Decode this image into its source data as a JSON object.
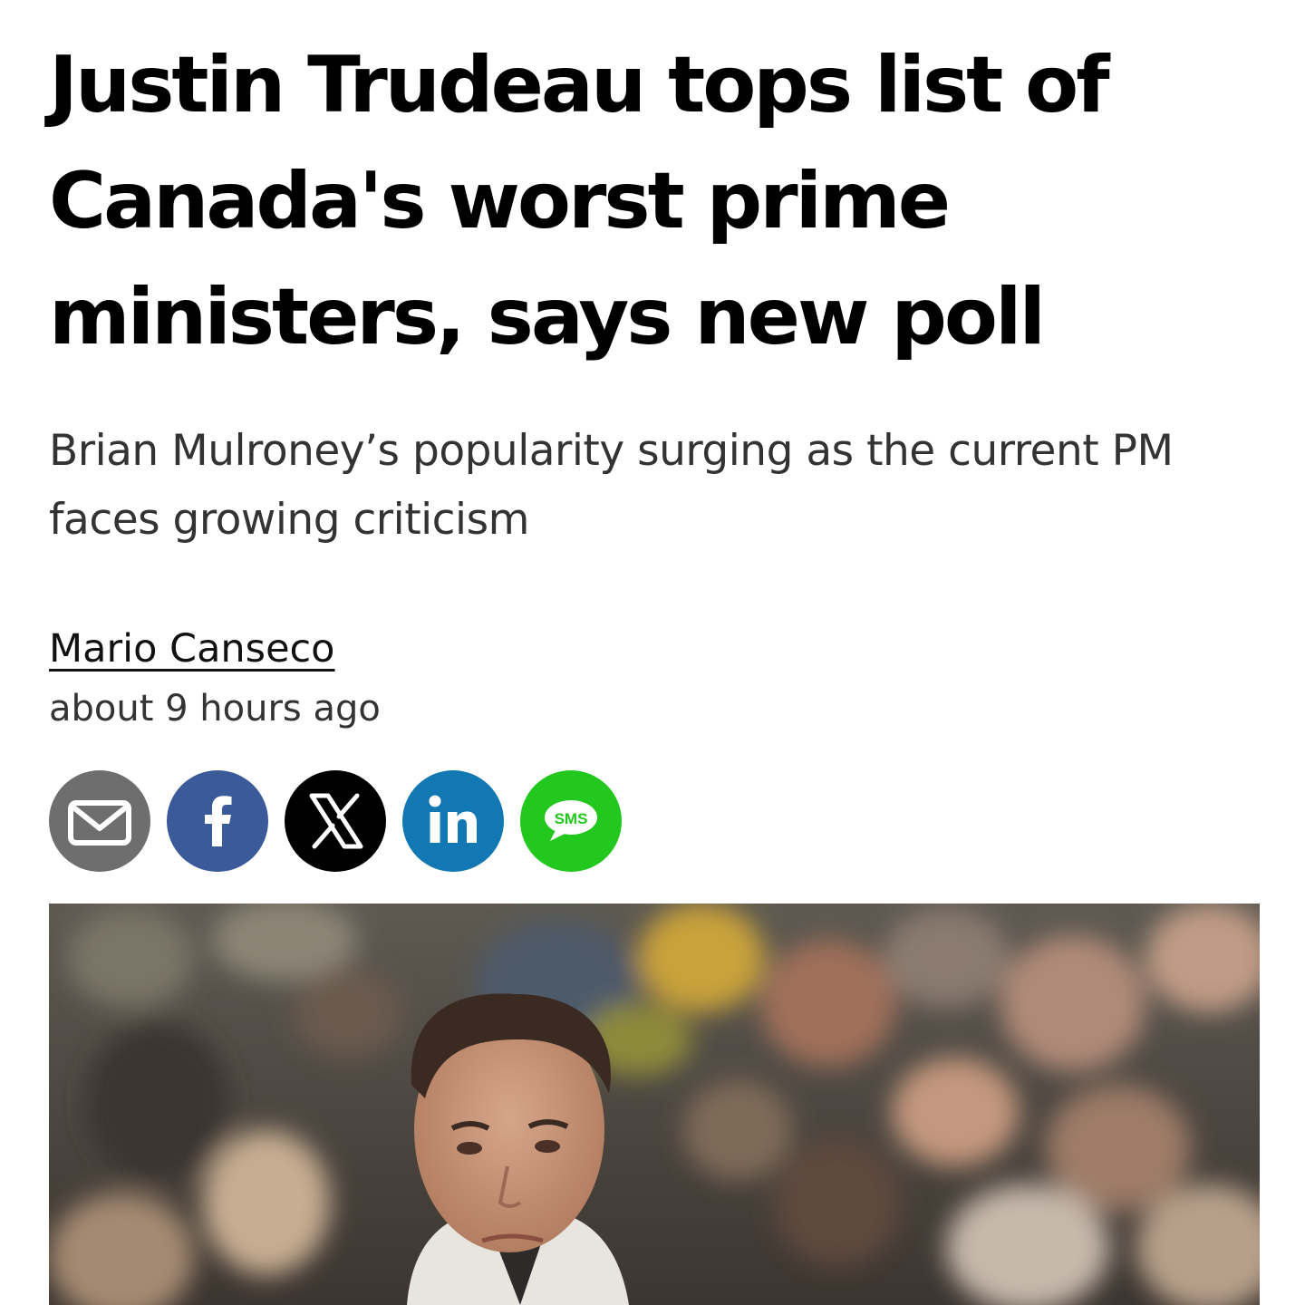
{
  "article": {
    "headline": "Justin Trudeau tops list of Canada's worst prime ministers, says new poll",
    "subheadline": "Brian Mulroney’s popularity surging as the current PM faces growing criticism",
    "author": "Mario Canseco",
    "published": "about 9 hours ago"
  },
  "share": {
    "buttons": [
      {
        "name": "email",
        "icon": "envelope-icon",
        "color": "#6e6e6e"
      },
      {
        "name": "facebook",
        "icon": "facebook-f-icon",
        "color": "#3b5a9a"
      },
      {
        "name": "x",
        "icon": "x-logo-icon",
        "color": "#000000"
      },
      {
        "name": "linkedin",
        "icon": "linkedin-in-icon",
        "color": "#1178b3"
      },
      {
        "name": "sms",
        "icon": "sms-bubble-icon",
        "color": "#23c81f",
        "label": "SMS"
      }
    ]
  },
  "hero_image": {
    "subject": "photo-of-man-in-front-of-crowd"
  }
}
